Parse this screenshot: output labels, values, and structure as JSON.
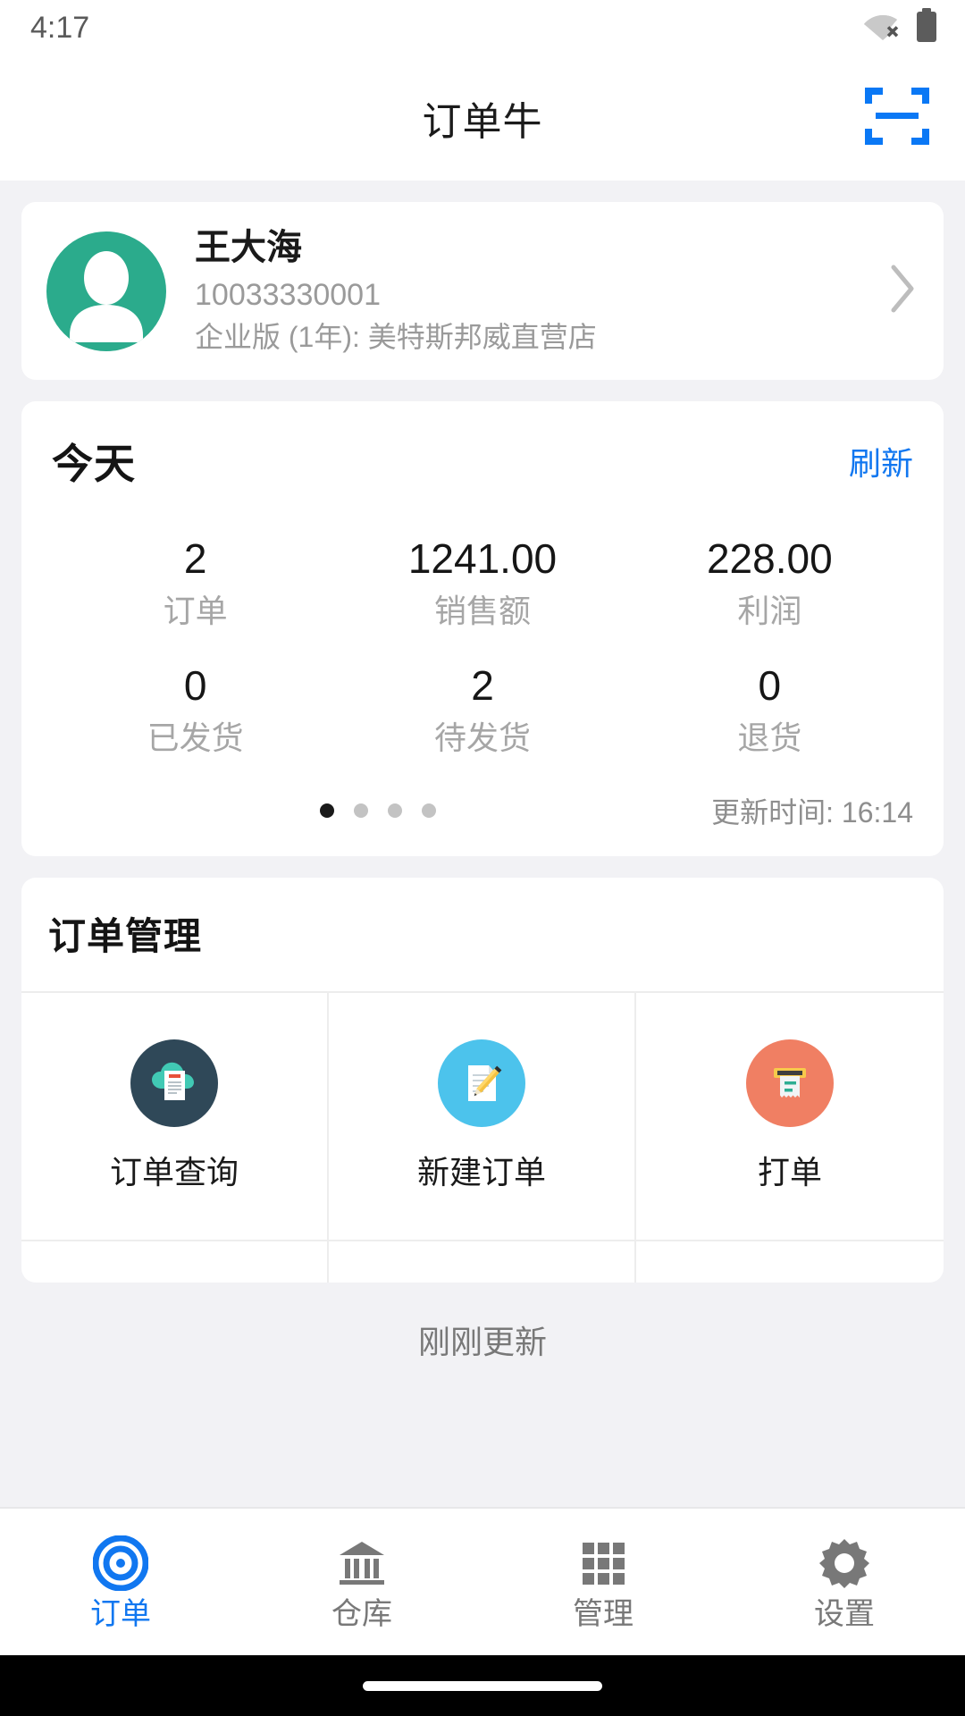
{
  "status_bar": {
    "time": "4:17",
    "wifi_icon": "wifi-off-icon",
    "battery_icon": "battery-full-icon"
  },
  "app_bar": {
    "title": "订单牛",
    "scan_icon": "scan-qr-icon",
    "accent_color": "#1177f0"
  },
  "profile": {
    "avatar_icon": "user-avatar-icon",
    "avatar_color": "#2bab8c",
    "name": "王大海",
    "account_id": "10033330001",
    "plan": "企业版 (1年): 美特斯邦威直营店",
    "chevron_icon": "chevron-right-icon"
  },
  "stats": {
    "title": "今天",
    "refresh_label": "刷新",
    "rows": [
      [
        {
          "value": "2",
          "label": "订单"
        },
        {
          "value": "1241.00",
          "label": "销售额"
        },
        {
          "value": "228.00",
          "label": "利润"
        }
      ],
      [
        {
          "value": "0",
          "label": "已发货"
        },
        {
          "value": "2",
          "label": "待发货"
        },
        {
          "value": "0",
          "label": "退货"
        }
      ]
    ],
    "dots": {
      "count": 4,
      "active_index": 0
    },
    "update_time": "更新时间: 16:14"
  },
  "order_management": {
    "title": "订单管理",
    "items": [
      {
        "label": "订单查询",
        "icon": "cloud-document-icon",
        "circle_color": "#2f4858"
      },
      {
        "label": "新建订单",
        "icon": "document-pencil-icon",
        "circle_color": "#4cc3ec"
      },
      {
        "label": "打单",
        "icon": "receipt-printer-icon",
        "circle_color": "#f07f63"
      }
    ]
  },
  "refresh_note": "刚刚更新",
  "tab_bar": {
    "tabs": [
      {
        "label": "订单",
        "icon": "target-icon",
        "active": true
      },
      {
        "label": "仓库",
        "icon": "bank-icon",
        "active": false
      },
      {
        "label": "管理",
        "icon": "grid-icon",
        "active": false
      },
      {
        "label": "设置",
        "icon": "gear-icon",
        "active": false
      }
    ],
    "active_color": "#1177f0",
    "inactive_color": "#787878"
  }
}
